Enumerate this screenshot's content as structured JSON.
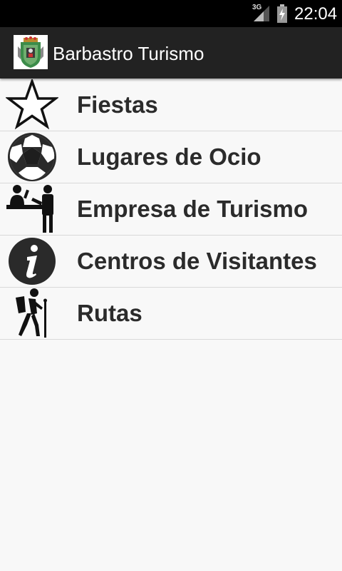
{
  "status_bar": {
    "network": "3G",
    "time": "22:04"
  },
  "action_bar": {
    "title": "Barbastro Turismo",
    "logo_icon": "coat-of-arms-icon"
  },
  "menu": {
    "items": [
      {
        "label": "Fiestas",
        "icon": "star-icon"
      },
      {
        "label": "Lugares de Ocio",
        "icon": "soccer-ball-icon"
      },
      {
        "label": "Empresa de Turismo",
        "icon": "reception-desk-icon"
      },
      {
        "label": "Centros de Visitantes",
        "icon": "info-icon"
      },
      {
        "label": "Rutas",
        "icon": "hiker-icon"
      }
    ]
  },
  "colors": {
    "status_bar_bg": "#000000",
    "action_bar_bg": "#222222",
    "list_bg": "#f8f8f8",
    "divider": "#d9d9d9",
    "label_text": "#2b2b2b"
  }
}
